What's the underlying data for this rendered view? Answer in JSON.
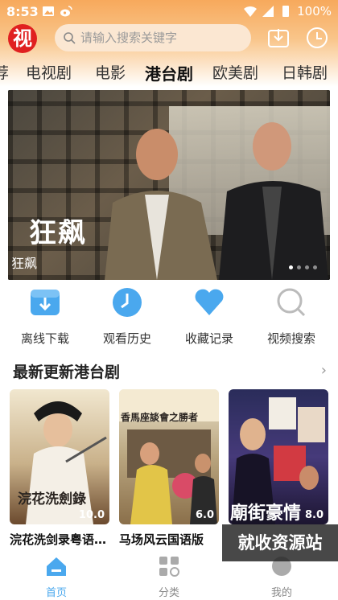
{
  "status": {
    "time": "8:53",
    "battery": "100%"
  },
  "app": {
    "logo_text": "视",
    "search_placeholder": "请输入搜索关键字"
  },
  "categories": {
    "items": [
      "荐",
      "电视剧",
      "电影",
      "港台剧",
      "欧美剧",
      "日韩剧"
    ],
    "active": "港台剧"
  },
  "banner": {
    "title": "狂飙",
    "label": "狂飙",
    "dot_count": 4,
    "active_dot": 1
  },
  "quick_actions": [
    {
      "label": "离线下载",
      "icon": "download-icon"
    },
    {
      "label": "观看历史",
      "icon": "clock-icon"
    },
    {
      "label": "收藏记录",
      "icon": "heart-icon"
    },
    {
      "label": "视频搜索",
      "icon": "search-icon"
    }
  ],
  "section": {
    "title": "最新更新港台剧",
    "more": "›"
  },
  "cards": [
    {
      "name": "浣花洗剑录粤语…",
      "score": "10.0",
      "poster_text": "浣花洗劍錄"
    },
    {
      "name": "马场风云国语版",
      "score": "6.0",
      "poster_text": "香馬座談會之勝者"
    },
    {
      "name": "",
      "score": "8.0",
      "poster_text": "廟街豪情"
    }
  ],
  "watermark": "就收资源站",
  "tabbar": [
    {
      "label": "首页",
      "icon": "home-icon",
      "active": true
    },
    {
      "label": "分类",
      "icon": "category-icon",
      "active": false
    },
    {
      "label": "我的",
      "icon": "user-icon",
      "active": false
    }
  ],
  "colors": {
    "accent": "#4aa8ee",
    "header": "#f7a95c",
    "logo": "#e02020"
  }
}
